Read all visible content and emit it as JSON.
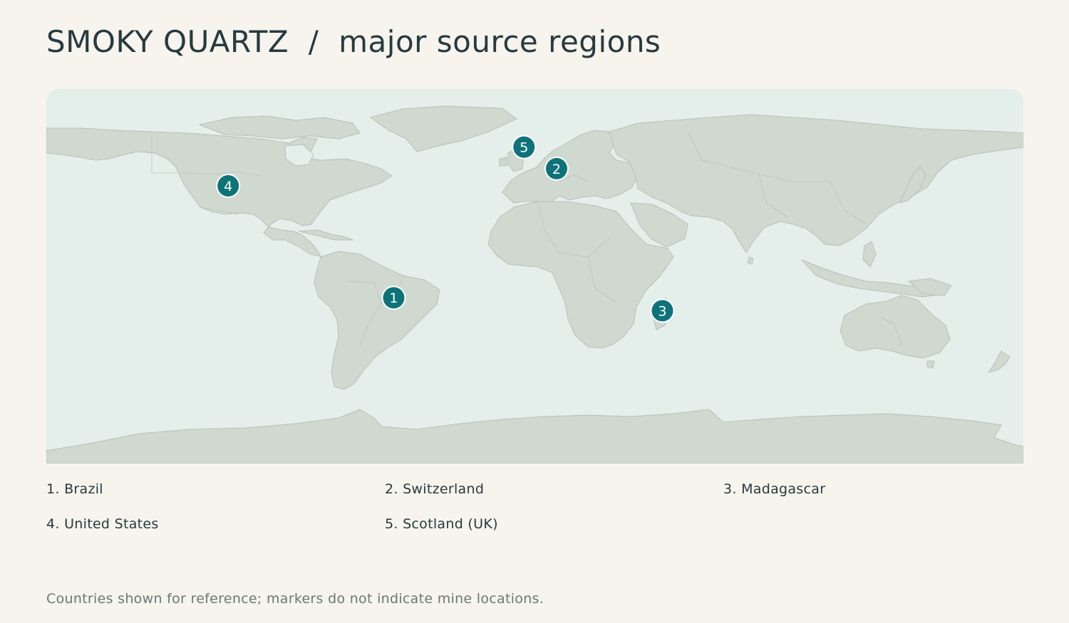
{
  "title": "SMOKY QUARTZ  /  major source regions",
  "map": {
    "colors": {
      "water": "#e4efeb",
      "land": "#cfd9cf",
      "border": "#b5c2b8",
      "marker": "#0e7379",
      "background": "#f6f4ec"
    },
    "markers": [
      {
        "number": "1",
        "region": "Brazil",
        "lon": -52,
        "lat": -13
      },
      {
        "number": "2",
        "region": "Switzerland",
        "lon": 8,
        "lat": 47
      },
      {
        "number": "3",
        "region": "Madagascar",
        "lon": 47,
        "lat": -19
      },
      {
        "number": "4",
        "region": "United States",
        "lon": -113,
        "lat": 39
      },
      {
        "number": "5",
        "region": "Scotland (UK)",
        "lon": -4,
        "lat": 57
      }
    ]
  },
  "legend": [
    {
      "label": "1. Brazil"
    },
    {
      "label": "2. Switzerland"
    },
    {
      "label": "3. Madagascar"
    },
    {
      "label": "4. United States"
    },
    {
      "label": "5. Scotland (UK)"
    }
  ],
  "footnote": "Countries shown for reference; markers do not indicate mine locations."
}
